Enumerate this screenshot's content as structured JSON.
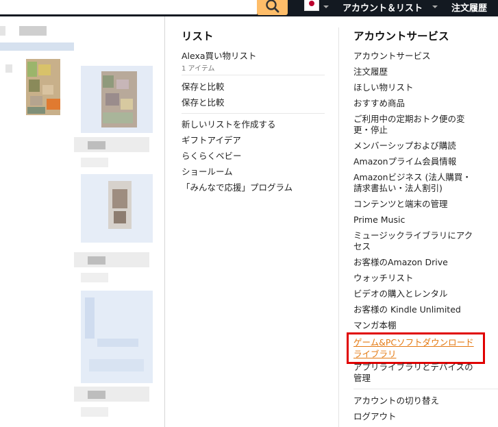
{
  "topbar": {
    "search_icon": "search-icon",
    "flag": "japan-flag-icon",
    "account_label": "アカウント＆リスト",
    "orders_label": "注文履歴"
  },
  "lists": {
    "heading": "リスト",
    "alexa_label": "Alexa買い物リスト",
    "alexa_count": "1 アイテム",
    "save_compare_1": "保存と比較",
    "save_compare_2": "保存と比較",
    "create_list": "新しいリストを作成する",
    "gift_ideas": "ギフトアイデア",
    "baby": "らくらくベビー",
    "showroom": "ショールーム",
    "support_program": "「みんなで応援」プログラム"
  },
  "account": {
    "heading": "アカウントサービス",
    "items": [
      "アカウントサービス",
      "注文履歴",
      "ほしい物リスト",
      "おすすめ商品",
      "ご利用中の定期おトク便の変",
      "更・停止",
      "メンバーシップおよび購読",
      "Amazonプライム会員情報",
      "Amazonビジネス (法人購買・",
      "請求書払い・法人割引)",
      "コンテンツと端末の管理",
      "Prime Music",
      "ミュージックライブラリにアク",
      "セス",
      "お客様のAmazon Drive",
      "ウォッチリスト",
      "ビデオの購入とレンタル",
      "お客様の Kindle Unlimited",
      "マンガ本棚"
    ],
    "highlight_line1": "ゲーム&PCソフトダウンロード",
    "highlight_line2": "ライブラリ",
    "app_library_1": "アプリライブラリとデバイスの",
    "app_library_2": "管理",
    "switch_account": "アカウントの切り替え",
    "logout": "ログアウト"
  },
  "colors": {
    "nav_bg": "#131921",
    "search_button": "#febd69",
    "link_orange": "#e47911",
    "highlight_border": "#e00000"
  }
}
